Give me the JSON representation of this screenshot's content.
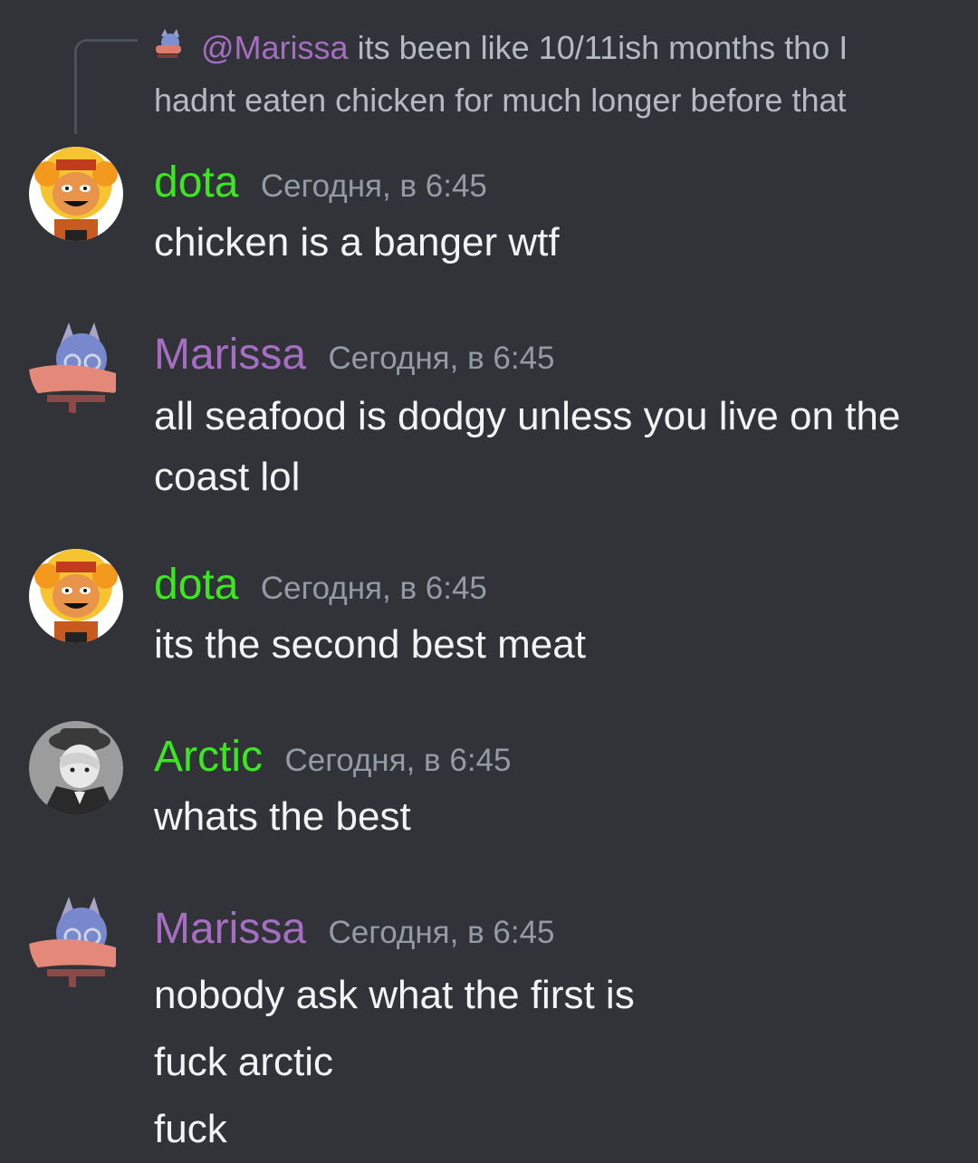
{
  "reply": {
    "mention": "@Marissa",
    "text_line1": "its been like 10/11ish months tho I",
    "text_line2": "hadnt eaten chicken for much longer before that"
  },
  "colors": {
    "background": "#313338",
    "dota": "#3ce621",
    "marissa": "#a56ec2",
    "arctic": "#3ce621",
    "timestamp": "#949ba4",
    "message_text": "#f2f3f5"
  },
  "messages": [
    {
      "author": "dota",
      "timestamp": "Сегодня, в 6:45",
      "lines": [
        "chicken is a banger wtf"
      ]
    },
    {
      "author": "Marissa",
      "timestamp": "Сегодня, в 6:45",
      "lines": [
        "all seafood is dodgy unless you live on the",
        "coast lol"
      ]
    },
    {
      "author": "dota",
      "timestamp": "Сегодня, в 6:45",
      "lines": [
        "its the second best meat"
      ]
    },
    {
      "author": "Arctic",
      "timestamp": "Сегодня, в 6:45",
      "lines": [
        "whats the best"
      ]
    },
    {
      "author": "Marissa",
      "timestamp": "Сегодня, в 6:45",
      "lines": [
        "nobody ask what the first is",
        "fuck arctic",
        "fuck"
      ]
    }
  ]
}
